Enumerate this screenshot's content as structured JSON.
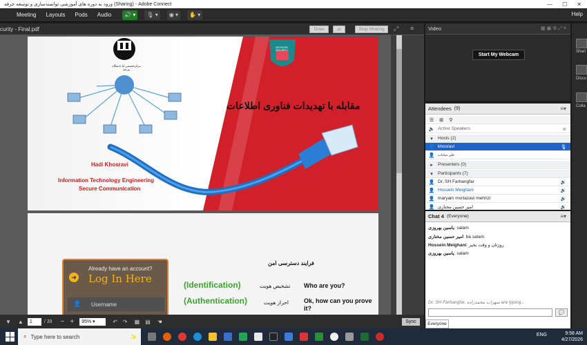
{
  "window": {
    "title": "ورود به دوره های آموزشی توانمندسازی و توسعه حرفه (Sharing) - Adobe Connect"
  },
  "menu": {
    "items": [
      "Meeting",
      "Layouts",
      "Pods",
      "Audio"
    ],
    "help": "Help"
  },
  "share_pod": {
    "title": "curity - Final.pdf",
    "draw": "Draw",
    "stop_sharing": "Stop Sharing"
  },
  "slide1": {
    "logo_text": "مرکزتخصصی آپا دانشگاه بیرجند",
    "heading": "مقابله با تهدیدات فناوری اطلاعات",
    "shield_text": "NETWORK SECURITY",
    "author": "Hadi Khosravi",
    "subtitle1": "Information Technology Engineering",
    "subtitle2": "Secure Communication"
  },
  "slide2": {
    "title": "فرایند دسترسی امن",
    "login_prompt": "Already have an account?",
    "login_title": "Log In Here",
    "username_placeholder": "Username",
    "rows": [
      {
        "en": "(Identification)",
        "fa": "تشخیص هویت",
        "q": "Who are you?"
      },
      {
        "en": "(Authentication)",
        "fa": "احراز هویت",
        "q": "Ok, how can you prove it?"
      }
    ]
  },
  "pdf_toolbar": {
    "page": "1",
    "total": "/ 39",
    "zoom": "95%",
    "sync": "Sync"
  },
  "video_pod": {
    "title": "Video",
    "button": "Start My Webcam"
  },
  "attendees": {
    "title": "Attendees",
    "count": "(9)",
    "active_speakers": "Active Speakers",
    "hosts_label": "Hosts (2)",
    "hosts": [
      "khosravi",
      "علی سادات"
    ],
    "presenters_label": "Presenters (0)",
    "participants_label": "Participants (7)",
    "participants": [
      "Dr. SH Farhangfar",
      "Hossein Meighani",
      "maryam mortazavi mehrizi",
      "امیر حسین مختاری"
    ]
  },
  "chat": {
    "title": "Chat 4",
    "scope": "(Everyone)",
    "messages": [
      {
        "user": "یاسین بهروزی",
        "text": "salam"
      },
      {
        "user": "امیر حسین مختاری",
        "text": "ba salam"
      },
      {
        "user": "Hossein Meighani",
        "text": "روزتان و وقت بخیر"
      },
      {
        "user": "یاسین بهروزی",
        "text": "salam"
      }
    ],
    "typing": "Dr. SH Farhangfar, سهراب محمدزاده are typing...",
    "tab": "Everyone"
  },
  "side_panel": {
    "items": [
      "Shari",
      "Discu",
      "Colla"
    ]
  },
  "taskbar": {
    "search_placeholder": "Type here to search",
    "lang": "ENG",
    "time": "9:58 AM",
    "date": "4/27/2026"
  },
  "colors": {
    "accent": "#1d63c8",
    "slide_red": "#d2202a",
    "green_text": "#3aa52c",
    "blue_text": "#1565c0"
  }
}
